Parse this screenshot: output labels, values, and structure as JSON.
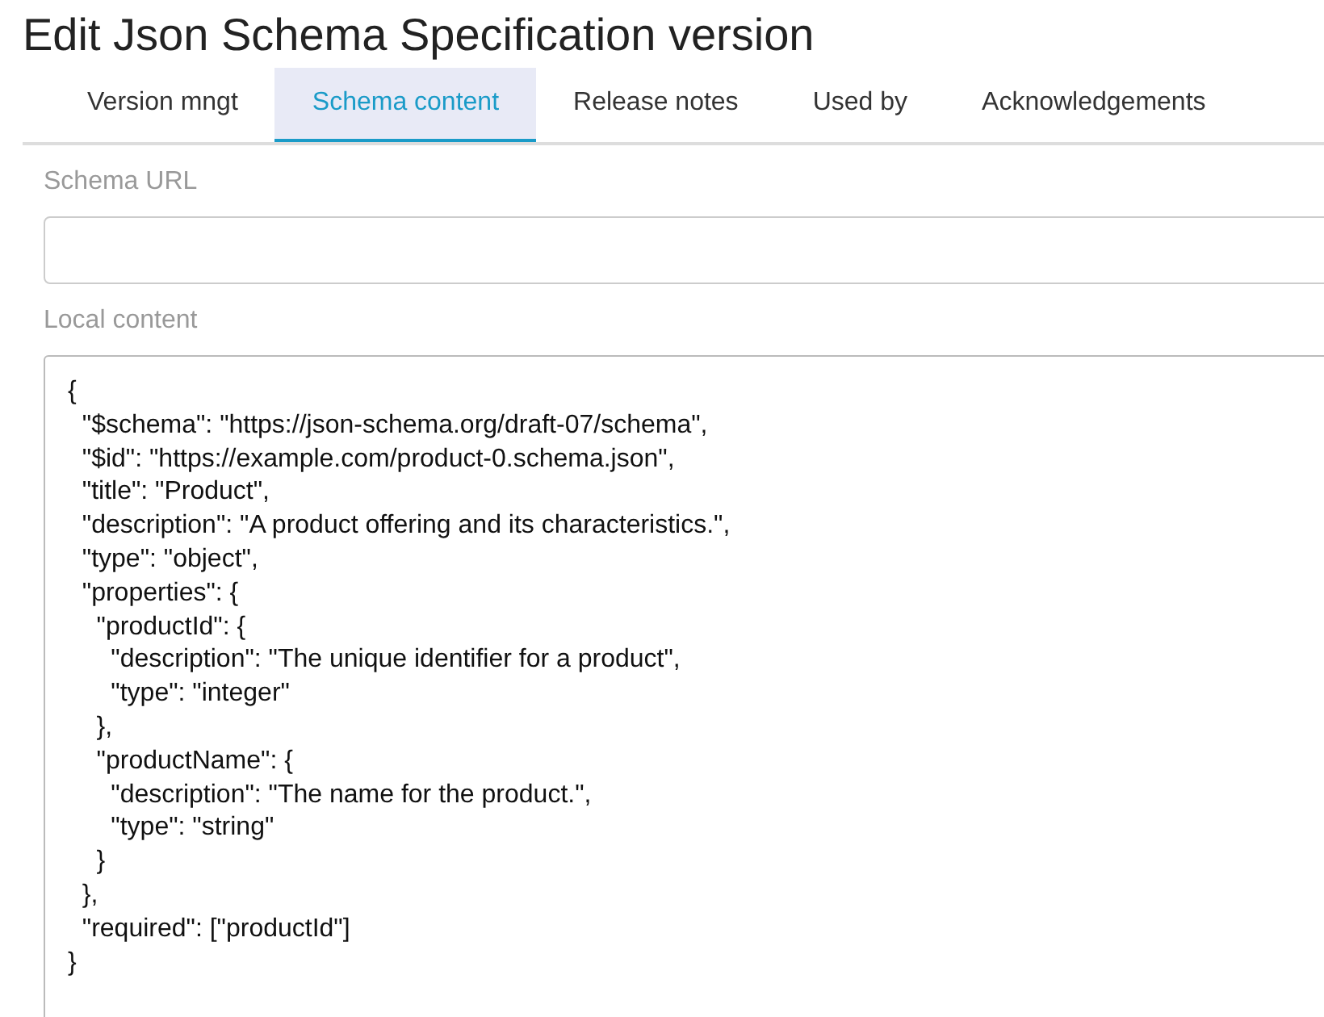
{
  "title": "Edit Json Schema Specification version",
  "tabs": [
    {
      "label": "Version mngt",
      "selected": false
    },
    {
      "label": "Schema content",
      "selected": true
    },
    {
      "label": "Release notes",
      "selected": false
    },
    {
      "label": "Used by",
      "selected": false
    },
    {
      "label": "Acknowledgements",
      "selected": false
    }
  ],
  "schema_url": {
    "label": "Schema URL"
  },
  "local_content": {
    "label": "Local content",
    "value": "{\n  \"$schema\": \"https://json-schema.org/draft-07/schema\",\n  \"$id\": \"https://example.com/product-0.schema.json\",\n  \"title\": \"Product\",\n  \"description\": \"A product offering and its characteristics.\",\n  \"type\": \"object\",\n  \"properties\": {\n    \"productId\": {\n      \"description\": \"The unique identifier for a product\",\n      \"type\": \"integer\"\n    },\n    \"productName\": {\n      \"description\": \"The name for the product.\",\n      \"type\": \"string\"\n    }\n  },\n  \"required\": [\"productId\"]\n}"
  }
}
